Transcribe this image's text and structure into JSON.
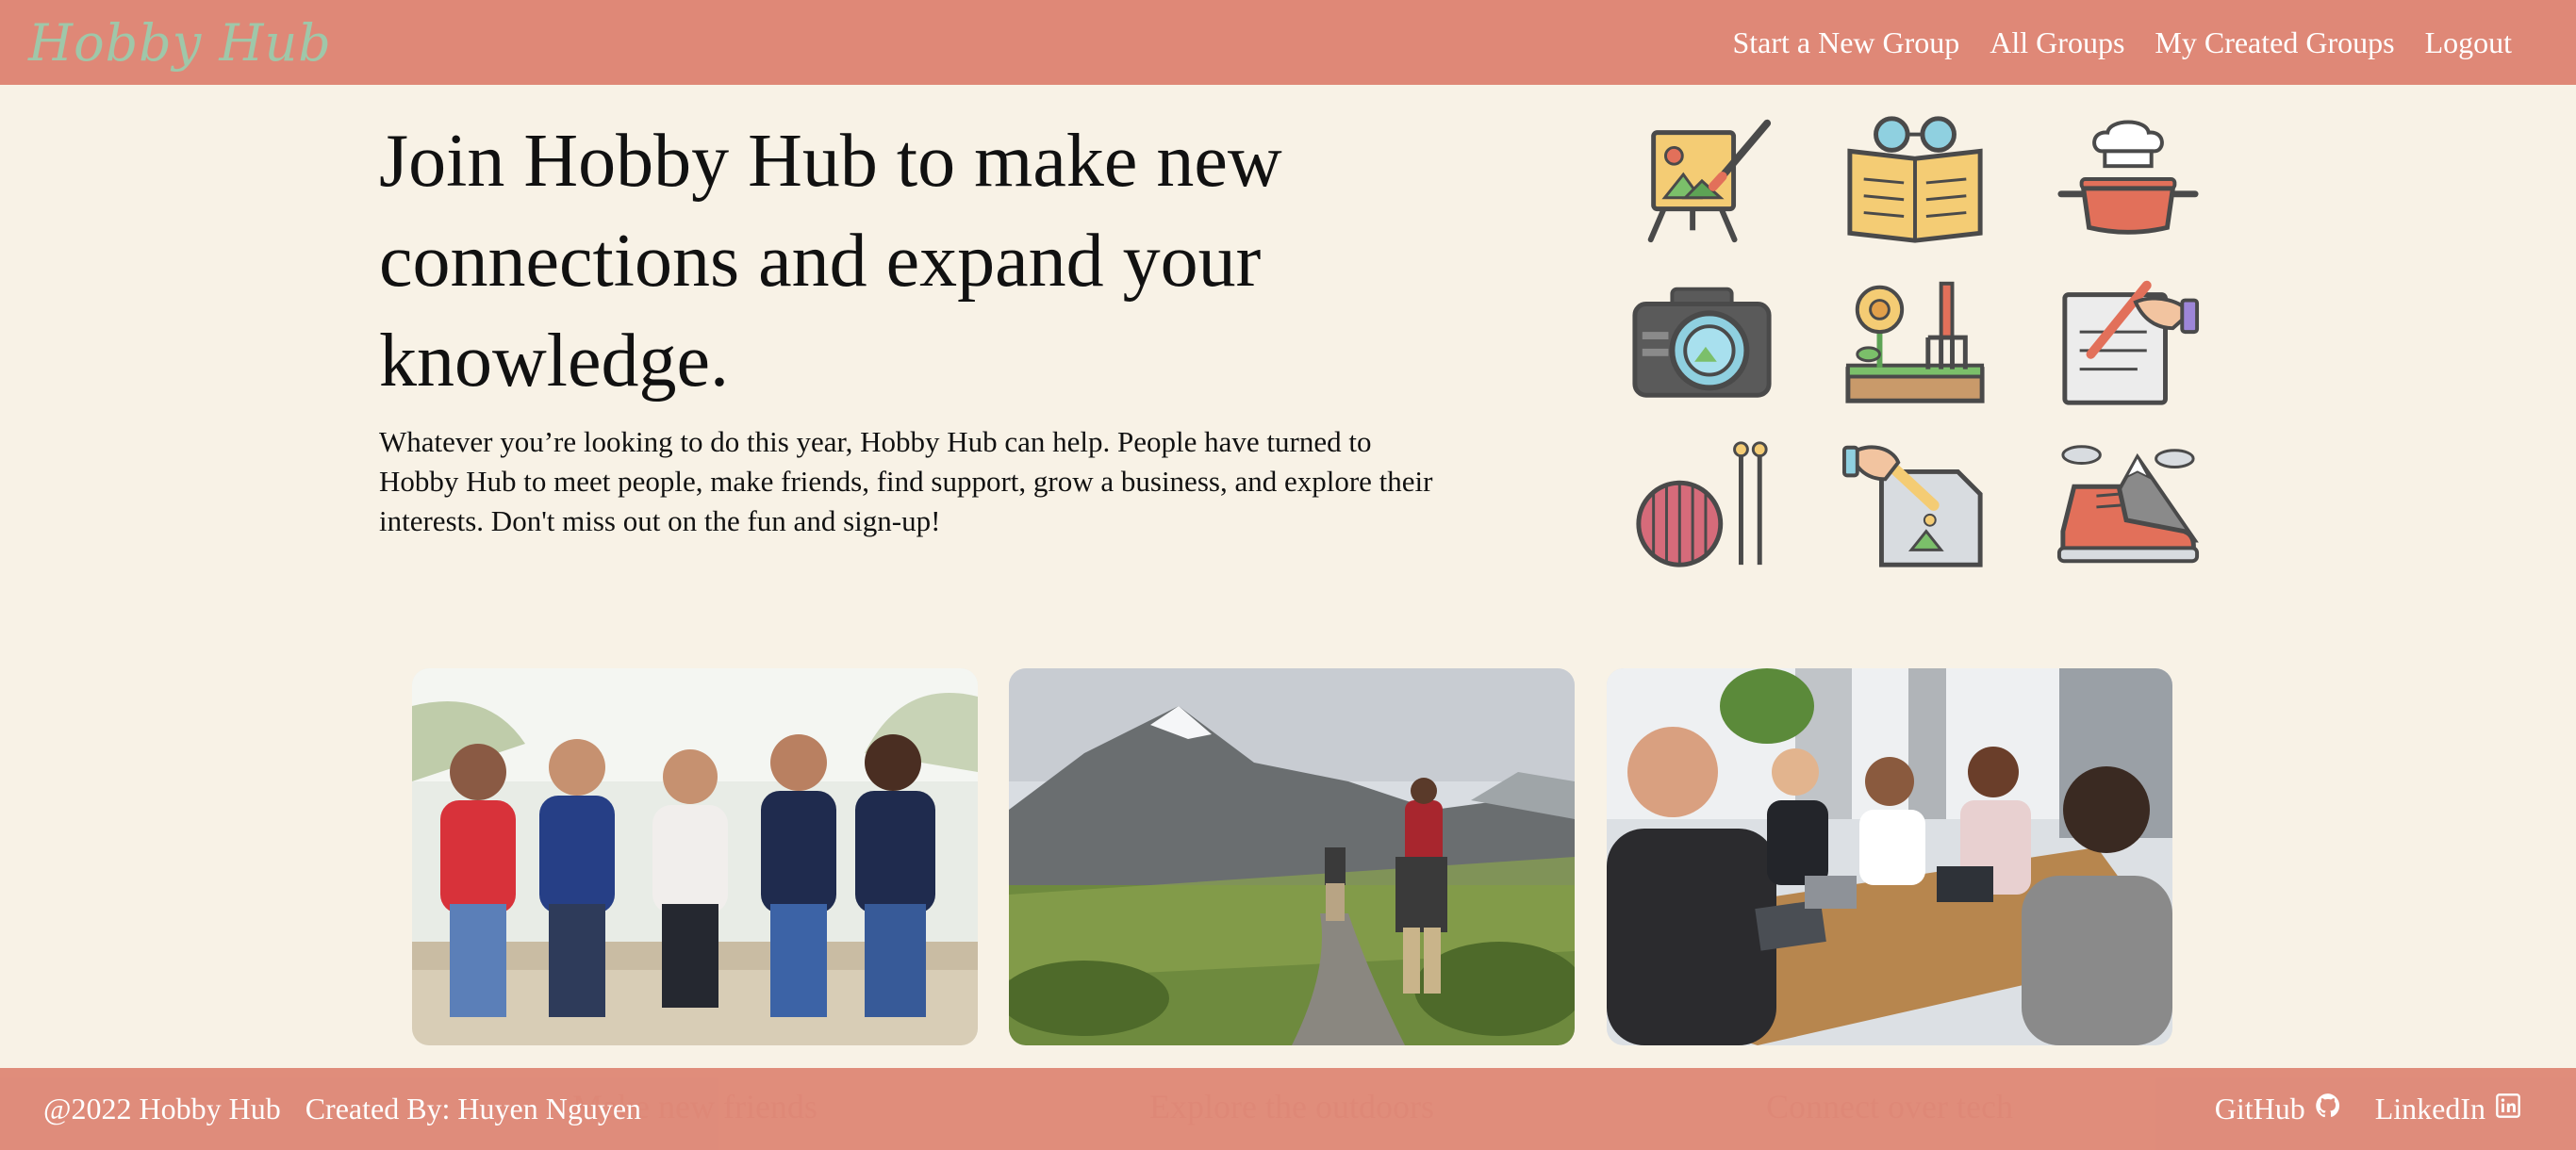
{
  "navbar": {
    "brand": "Hobby Hub",
    "links": [
      "Start a New Group",
      "All Groups",
      "My Created Groups",
      "Logout"
    ]
  },
  "hero": {
    "title": "Join Hobby Hub to make new connections and expand your knowledge.",
    "text": "Whatever you’re looking to do this year, Hobby Hub can help. People have turned to Hobby Hub to meet people, make friends, find support, grow a business, and explore their interests. Don't miss out on the fun and sign-up!"
  },
  "icons": [
    "painting-easel-icon",
    "book-glasses-icon",
    "cooking-pot-icon",
    "camera-icon",
    "gardening-icon",
    "writing-icon",
    "knitting-icon",
    "drawing-icon",
    "hiking-boot-icon"
  ],
  "cards": [
    {
      "caption": "Make new friends"
    },
    {
      "caption": "Explore the outdoors"
    },
    {
      "caption": "Connect over tech"
    }
  ],
  "footer": {
    "copyright": "@2022 Hobby Hub",
    "created_by": "Created By: Huyen Nguyen",
    "github": "GitHub",
    "linkedin": "LinkedIn"
  },
  "colors": {
    "accent": "#df8877",
    "background": "#f8f2e6",
    "brand_text": "#9fc7a9"
  }
}
